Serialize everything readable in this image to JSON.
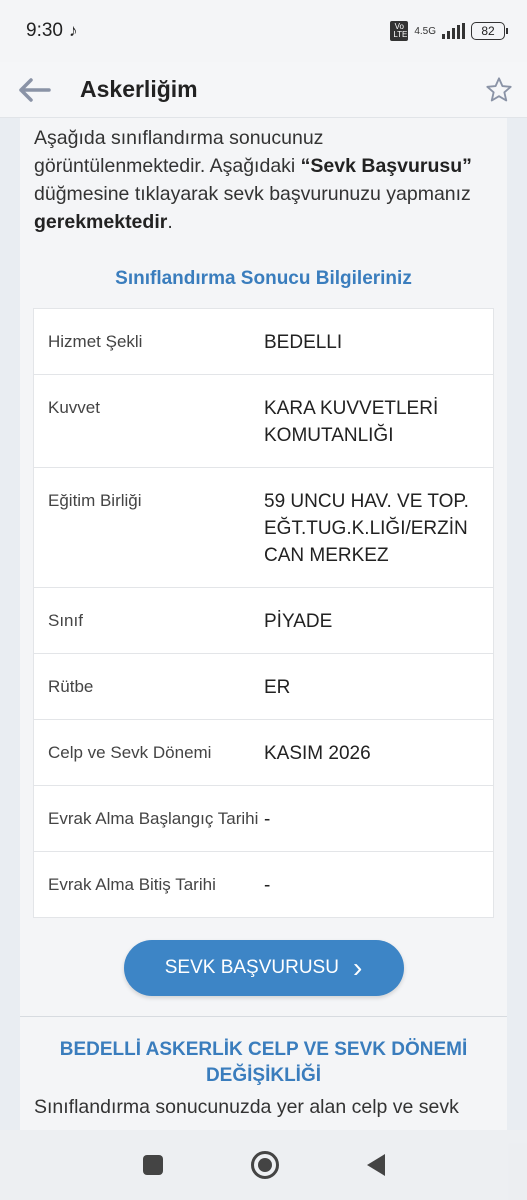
{
  "status_bar": {
    "time": "9:30",
    "volte_label": "Vo LTE",
    "network_label": "4.5G",
    "battery": "82"
  },
  "header": {
    "title": "Askerliğim"
  },
  "intro": {
    "part1": "Aşağıda sınıflandırma sonucunuz görüntülenmektedir. Aşağıdaki ",
    "bold1": "“Sevk Başvurusu”",
    "part2": " düğmesine tıklayarak sevk başvurunuzu yapmanız ",
    "bold2": "gerekmektedir",
    "part3": "."
  },
  "section_title": "Sınıflandırma Sonucu Bilgileriniz",
  "rows": [
    {
      "label": "Hizmet Şekli",
      "value": "BEDELLI"
    },
    {
      "label": "Kuvvet",
      "value": "KARA KUVVETLERİ KOMUTANLIĞI"
    },
    {
      "label": "Eğitim Birliği",
      "value": "59 UNCU HAV. VE TOP.EĞT.TUG.K.LIĞI/ERZİNCAN MERKEZ"
    },
    {
      "label": "Sınıf",
      "value": "PİYADE"
    },
    {
      "label": "Rütbe",
      "value": "ER"
    },
    {
      "label": "Celp ve Sevk Dönemi",
      "value": "KASIM 2026"
    },
    {
      "label": "Evrak Alma Başlangıç Tarihi",
      "value": "-"
    },
    {
      "label": "Evrak Alma Bitiş Tarihi",
      "value": "-"
    }
  ],
  "sevk_button": {
    "label": "SEVK BAŞVURUSU",
    "arrow": "›"
  },
  "section2": {
    "title": "BEDELLİ ASKERLİK CELP VE SEVK DÖNEMİ DEĞİŞİKLİĞİ",
    "text": "Sınıflandırma sonucunuzda yer alan celp ve sevk"
  }
}
